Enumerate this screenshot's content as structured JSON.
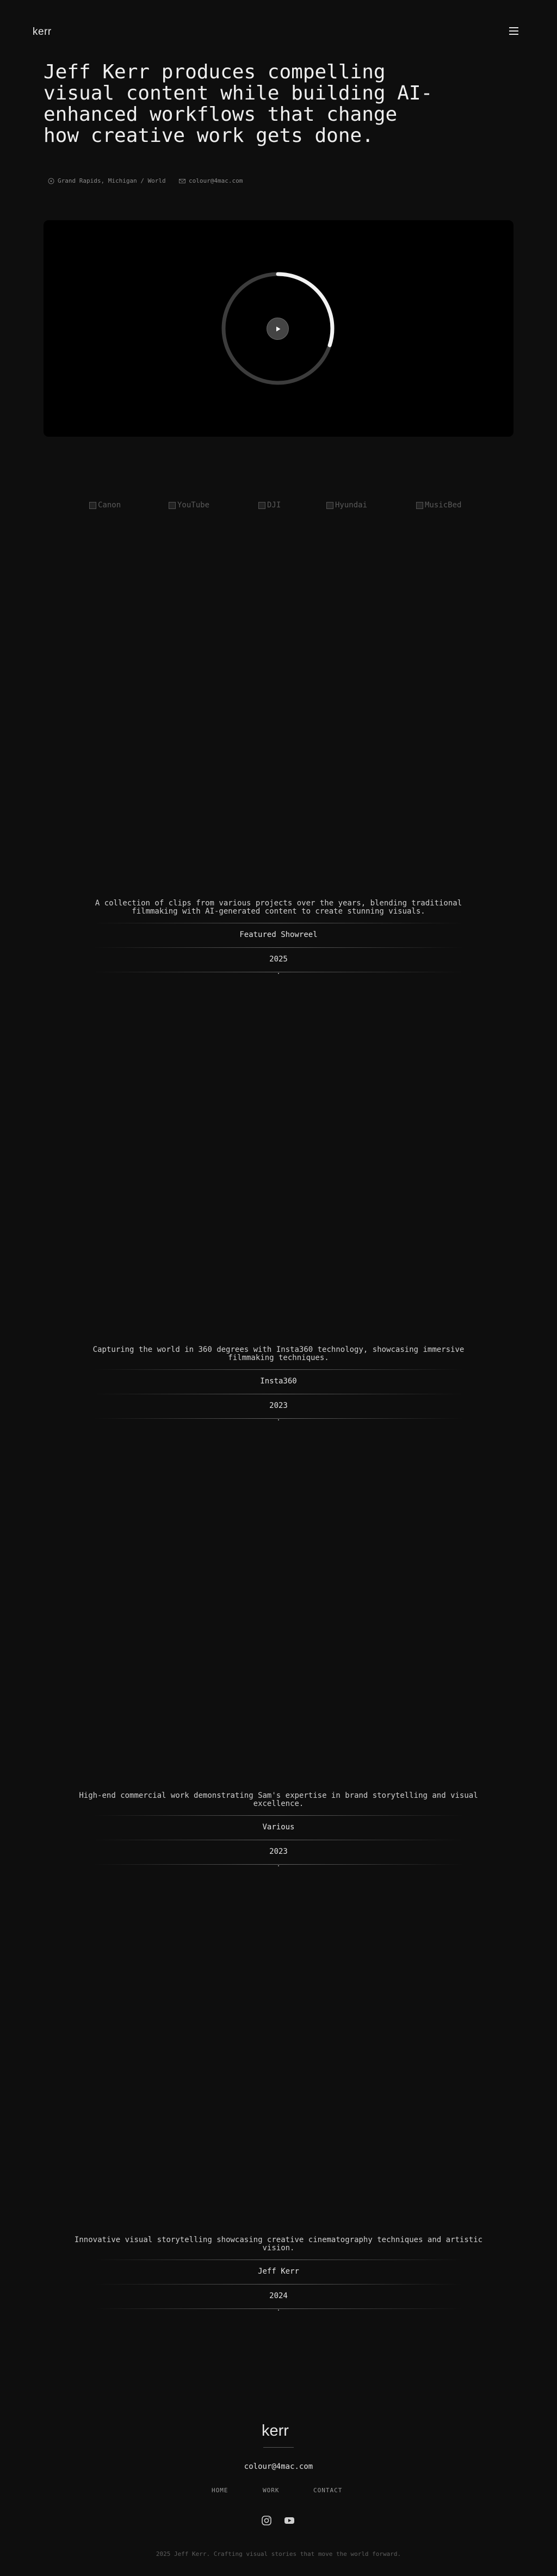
{
  "header": {
    "logo": "kerr",
    "menu_icon": "hamburger-icon"
  },
  "hero": {
    "headline": "Jeff Kerr produces compelling visual content while building AI-enhanced workflows that change how creative work gets done.",
    "location": "Grand Rapids, Michigan / World",
    "email": "colour@4mac.com"
  },
  "video": {
    "play_icon": "play-icon",
    "progress": 0.3
  },
  "logos": [
    "Canon",
    "YouTube",
    "DJI",
    "Hyundai",
    "MusicBed"
  ],
  "projects": [
    {
      "description": "A collection of clips from various projects over the years, blending traditional filmmaking with AI-generated content to create stunning visuals.",
      "client": "Featured Showreel",
      "year": "2025"
    },
    {
      "description": "Capturing the world in 360 degrees with Insta360 technology, showcasing immersive filmmaking techniques.",
      "client": "Insta360",
      "year": "2023"
    },
    {
      "description": "High-end commercial work demonstrating Sam's expertise in brand storytelling and visual excellence.",
      "client": "Various",
      "year": "2023"
    },
    {
      "description": "Innovative visual storytelling showcasing creative cinematography techniques and artistic vision.",
      "client": "Jeff Kerr",
      "year": "2024"
    }
  ],
  "footer": {
    "logo": "kerr",
    "email": "colour@4mac.com",
    "nav": [
      "HOME",
      "WORK",
      "CONTACT"
    ],
    "social": [
      "instagram-icon",
      "youtube-icon"
    ],
    "copyright": "2025 Jeff Kerr. Crafting visual stories that move the world forward."
  }
}
